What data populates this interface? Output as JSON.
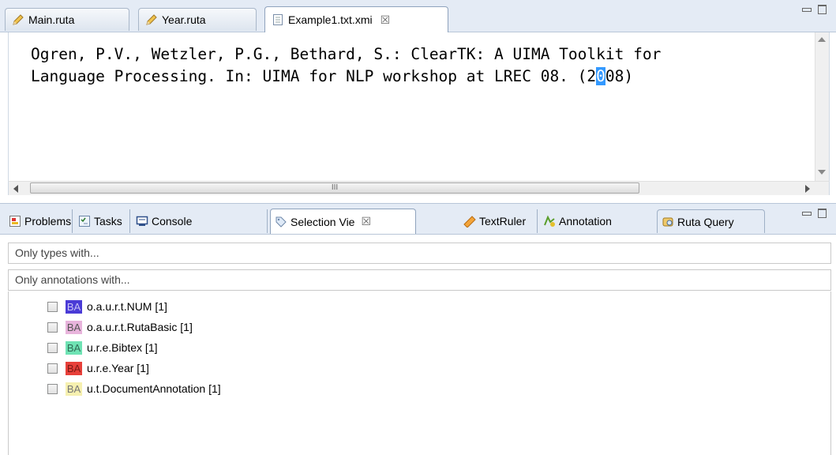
{
  "editor_tabs": [
    {
      "label": "Main.ruta",
      "icon": "pencil-icon"
    },
    {
      "label": "Year.ruta",
      "icon": "pencil-icon"
    },
    {
      "label": "Example1.txt.xmi",
      "icon": "document-icon",
      "close": "☒"
    }
  ],
  "editor": {
    "line1": "Ogren, P.V., Wetzler, P.G., Bethard, S.: ClearTK: A UIMA Toolkit for",
    "line2_before": "Language Processing. In: UIMA for NLP workshop at LREC 08. (2",
    "line2_selected": "0",
    "line2_after": "08)"
  },
  "hscroll_thumb_label": "III",
  "view_tabs": [
    {
      "label": "Problems",
      "icon": "problems-icon"
    },
    {
      "label": "Tasks",
      "icon": "tasks-icon"
    },
    {
      "label": "Console",
      "icon": "console-icon"
    },
    {
      "label": "Selection Vie",
      "icon": "tag-icon",
      "close": "☒"
    },
    {
      "label": "TextRuler",
      "icon": "ruler-icon"
    },
    {
      "label": "Annotation",
      "icon": "annotation-icon"
    },
    {
      "label": "Ruta Query",
      "icon": "query-icon"
    }
  ],
  "filters": {
    "types_placeholder": "Only types with...",
    "annotations_placeholder": "Only annotations with..."
  },
  "annotations": [
    {
      "badge": "BA",
      "color": "#4a3bd6",
      "label": "o.a.u.r.t.NUM [1]"
    },
    {
      "badge": "BA",
      "color": "#e8b4dc",
      "label": "o.a.u.r.t.RutaBasic [1]"
    },
    {
      "badge": "BA",
      "color": "#6fe3b4",
      "label": "u.r.e.Bibtex [1]"
    },
    {
      "badge": "BA",
      "color": "#e8403a",
      "label": "u.r.e.Year [1]"
    },
    {
      "badge": "BA",
      "color": "#f6f0b0",
      "label": "u.t.DocumentAnnotation [1]"
    }
  ]
}
